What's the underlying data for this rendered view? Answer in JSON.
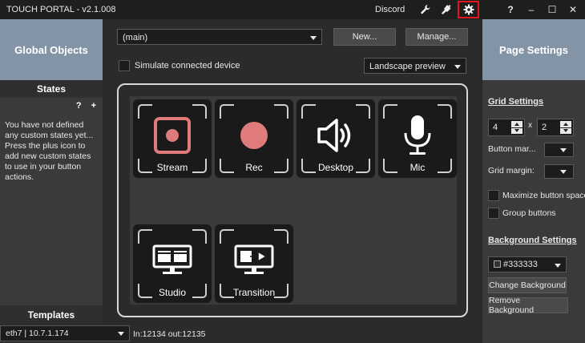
{
  "window": {
    "title": "TOUCH PORTAL - v2.1.008",
    "discord_label": "Discord",
    "help_label": "?",
    "minimize_label": "–",
    "maximize_label": "☐",
    "close_label": "✕"
  },
  "left_panel": {
    "header": "Global Objects",
    "states_title": "States",
    "help_label": "?",
    "add_label": "+",
    "info_text": "You have not defined any custom states yet... Press the plus icon to add new custom states to use in your button actions.",
    "templates_title": "Templates"
  },
  "toolbar": {
    "page_select": "(main)",
    "new_label": "New...",
    "manage_label": "Manage...",
    "simulate_label": "Simulate connected device",
    "preview_select": "Landscape preview"
  },
  "buttons": [
    {
      "label": "Stream",
      "icon": "stream-icon"
    },
    {
      "label": "Rec",
      "icon": "record-icon"
    },
    {
      "label": "Desktop",
      "icon": "speaker-icon"
    },
    {
      "label": "Mic",
      "icon": "microphone-icon"
    },
    {
      "label": "Studio",
      "icon": "studio-monitors-icon"
    },
    {
      "label": "Transition",
      "icon": "transition-icon"
    }
  ],
  "page_settings": {
    "header": "Page Settings",
    "grid_settings_title": "Grid Settings",
    "columns": "4",
    "times_label": "x",
    "rows": "2",
    "button_margin_label": "Button mar...",
    "grid_margin_label": "Grid margin:",
    "maximize_label": "Maximize button space",
    "group_label": "Group buttons",
    "background_title": "Background Settings",
    "background_color": "#333333",
    "change_bg_label": "Change Background",
    "remove_bg_label": "Remove Background"
  },
  "status": {
    "network": "eth7 | 10.7.1.174",
    "io": "In:12134 out:12135"
  },
  "colors": {
    "accent_header": "#8394a6",
    "record_red": "#e07b7b",
    "highlight_border": "#e8141b"
  }
}
